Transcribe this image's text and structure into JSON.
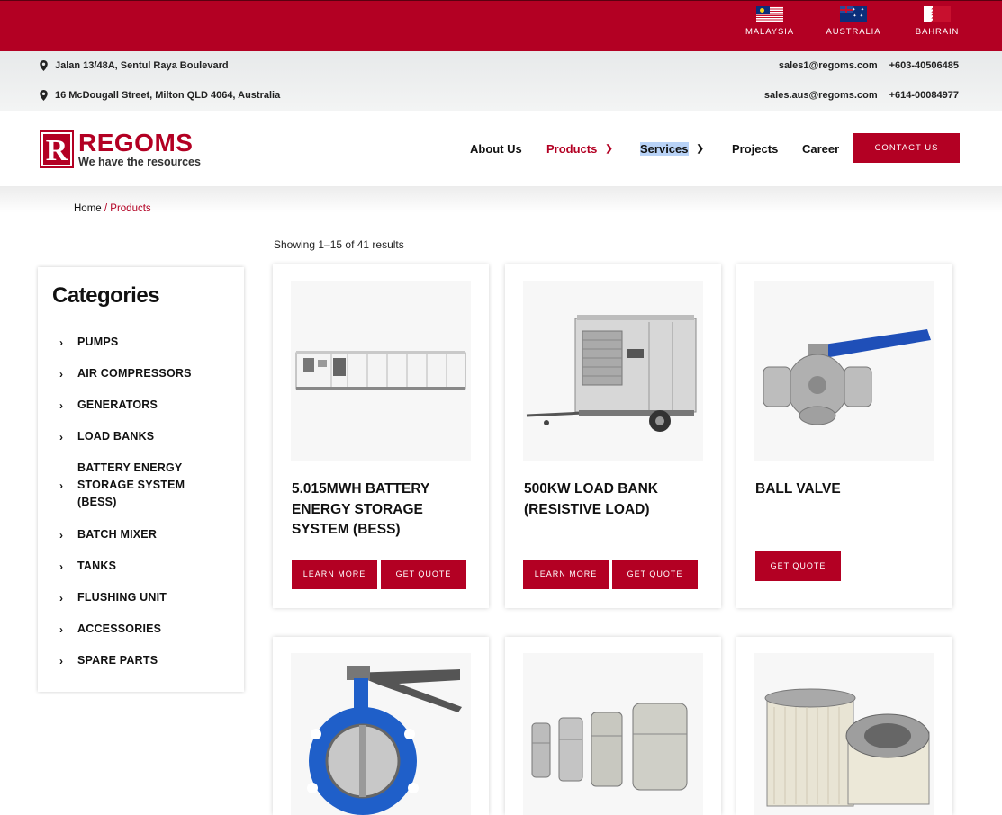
{
  "countries": [
    {
      "label": "MALAYSIA",
      "flag": "malaysia-flag"
    },
    {
      "label": "AUSTRALIA",
      "flag": "australia-flag"
    },
    {
      "label": "BAHRAIN",
      "flag": "bahrain-flag"
    }
  ],
  "contacts": {
    "address_1": "Jalan 13/48A, Sentul Raya Boulevard",
    "address_2": "16 McDougall Street, Milton QLD 4064, Australia",
    "email_1": "sales1@regoms.com",
    "phone_1": "+603-40506485",
    "email_2": "sales.aus@regoms.com",
    "phone_2": "+614-00084977"
  },
  "logo": {
    "letter": "R",
    "name": "REGOMS",
    "tagline": "We have the resources"
  },
  "nav": {
    "about": "About Us",
    "products": "Products",
    "services": "Services",
    "projects": "Projects",
    "career": "Career",
    "contact_button": "CONTACT US"
  },
  "breadcrumb": {
    "home": "Home",
    "separator": " / ",
    "current": "Products"
  },
  "result_count": "Showing 1–15 of 41 results",
  "sidebar": {
    "title": "Categories",
    "items": [
      "PUMPS",
      "AIR COMPRESSORS",
      "GENERATORS",
      "LOAD BANKS",
      "BATTERY ENERGY STORAGE SYSTEM (BESS)",
      "BATCH MIXER",
      "TANKS",
      "FLUSHING UNIT",
      "ACCESSORIES",
      "SPARE PARTS"
    ]
  },
  "products": [
    {
      "title": "5.015MWH BATTERY ENERGY STORAGE SYSTEM (BESS)",
      "learn_more": "LEARN MORE",
      "get_quote": "GET QUOTE"
    },
    {
      "title": "500KW LOAD BANK (RESISTIVE LOAD)",
      "learn_more": "LEARN MORE",
      "get_quote": "GET QUOTE"
    },
    {
      "title": "BALL VALVE",
      "get_quote": "GET QUOTE"
    },
    {
      "title": ""
    },
    {
      "title": ""
    },
    {
      "title": ""
    }
  ],
  "colors": {
    "brand_red": "#b30023",
    "contact_bar": "#eceeef"
  },
  "icons": {
    "address": "map-pin-icon",
    "dropdown": "chevron-down-icon",
    "category": "chevron-right-icon"
  }
}
